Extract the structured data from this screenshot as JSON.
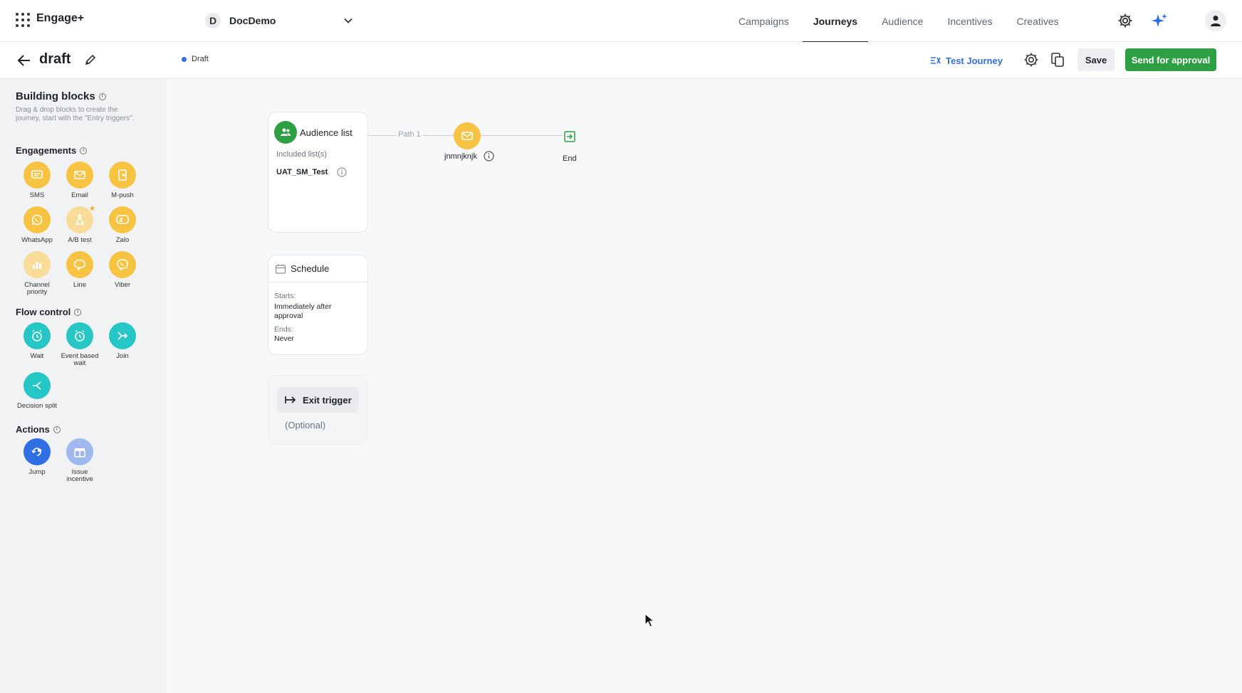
{
  "app": {
    "brand": "Engage+"
  },
  "workspace": {
    "initial": "D",
    "name": "DocDemo"
  },
  "nav": {
    "tabs": [
      "Campaigns",
      "Journeys",
      "Audience",
      "Incentives",
      "Creatives"
    ],
    "active": "Journeys"
  },
  "subheader": {
    "title": "draft",
    "status": "Draft",
    "test_journey": "Test Journey",
    "save": "Save",
    "send_for_approval": "Send for approval"
  },
  "sidebar": {
    "title": "Building blocks",
    "description": "Drag & drop blocks to create the journey, start with the \"Entry triggers\".",
    "engagements": {
      "title": "Engagements",
      "items": [
        "SMS",
        "Email",
        "M-push",
        "WhatsApp",
        "A/B test",
        "Zalo",
        "Channel priority",
        "Line",
        "Viber"
      ]
    },
    "flow_control": {
      "title": "Flow control",
      "items": [
        "Wait",
        "Event based wait",
        "Join",
        "Decision split"
      ]
    },
    "actions": {
      "title": "Actions",
      "items": [
        "Jump",
        "Issue incentive"
      ]
    }
  },
  "canvas": {
    "audience": {
      "title": "Audience list",
      "subtitle": "Included list(s)",
      "list": "UAT_SM_Test"
    },
    "schedule": {
      "title": "Schedule",
      "starts_label": "Starts:",
      "starts_value": "Immediately after approval",
      "ends_label": "Ends:",
      "ends_value": "Never"
    },
    "exit": {
      "title": "Exit trigger",
      "optional": "(Optional)"
    },
    "path_label": "Path 1",
    "email_node": "jnmnjknjk",
    "end_label": "End"
  },
  "colors": {
    "primary_blue": "#2f6fe4",
    "success_green": "#2ea043",
    "engagement_yellow": "#f6c343",
    "flow_teal": "#26c6c6"
  }
}
